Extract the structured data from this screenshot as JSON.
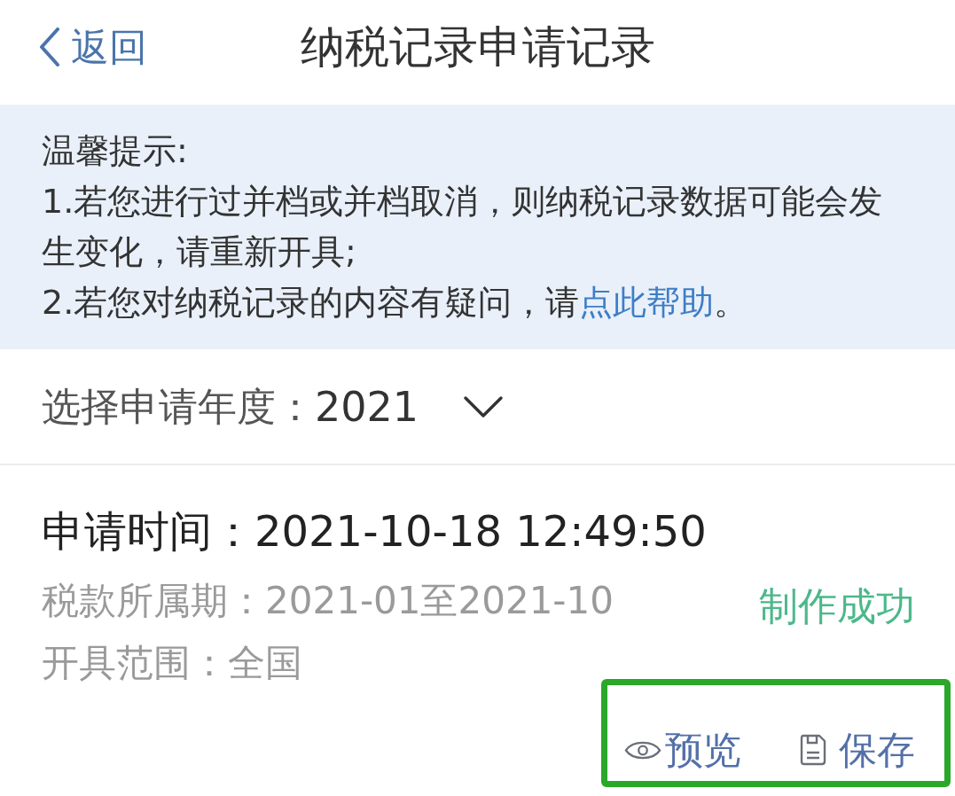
{
  "nav": {
    "back_label": "返回",
    "title": "纳税记录申请记录"
  },
  "notice": {
    "heading": "温馨提示:",
    "items": [
      {
        "text": "1.若您进行过并档或并档取消，则纳税记录数据可能会发生变化，请重新开具;"
      },
      {
        "text": "2.若您对纳税记录的内容有疑问，请",
        "link": "点此帮助",
        "suffix": "。"
      }
    ]
  },
  "year_filter": {
    "label": "选择申请年度：",
    "value": "2021"
  },
  "records": [
    {
      "time": "申请时间：2021-10-18 12:49:50",
      "period": "税款所属期：2021-01至2021-10",
      "scope": "开具范围：全国",
      "status": "制作成功",
      "highlighted": true,
      "actions": [
        {
          "kind": "preview",
          "label": "预览"
        },
        {
          "kind": "save",
          "label": "保存"
        }
      ]
    }
  ]
}
